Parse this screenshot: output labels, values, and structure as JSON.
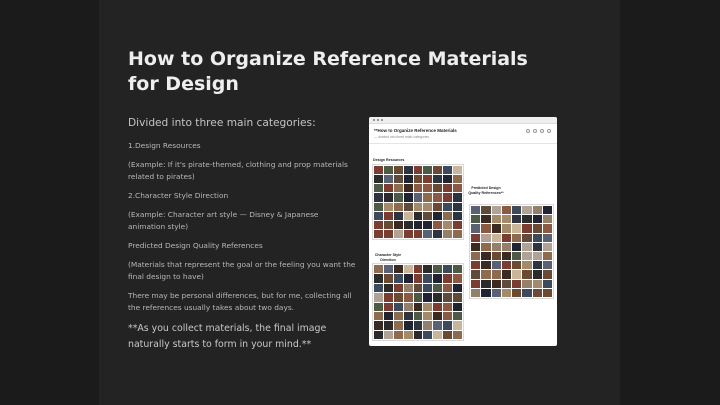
{
  "title": "How to Organize Reference Materials for Design",
  "intro": "Divided into three main categories:",
  "paragraphs": [
    "1.Design Resources",
    "(Example: If it's pirate-themed, clothing and prop materials related to pirates)",
    "2.Character Style Direction",
    "(Example: Character art style — Disney & Japanese animation style)",
    "Predicted Design Quality References",
    "(Materials that represent the goal or the feeling you want the final design to have)",
    "There may be personal differences, but for me, collecting all the references usually takes about two days."
  ],
  "emphasis": "**As you collect materials, the final image naturally starts to form in your mind.**",
  "screenshot": {
    "doc_title": "**How to Organize Reference Materials",
    "doc_subtitle": "— divided into three main categories",
    "board_labels": {
      "design_resources": "Design Resources",
      "predicted": "Predicted Design Quality References**",
      "character_style": "Character Style Direction"
    }
  },
  "colors": {
    "background": "#1b1b1b",
    "slide": "#232323",
    "title": "#eeeeee",
    "body_text": "#b8b8b8"
  }
}
